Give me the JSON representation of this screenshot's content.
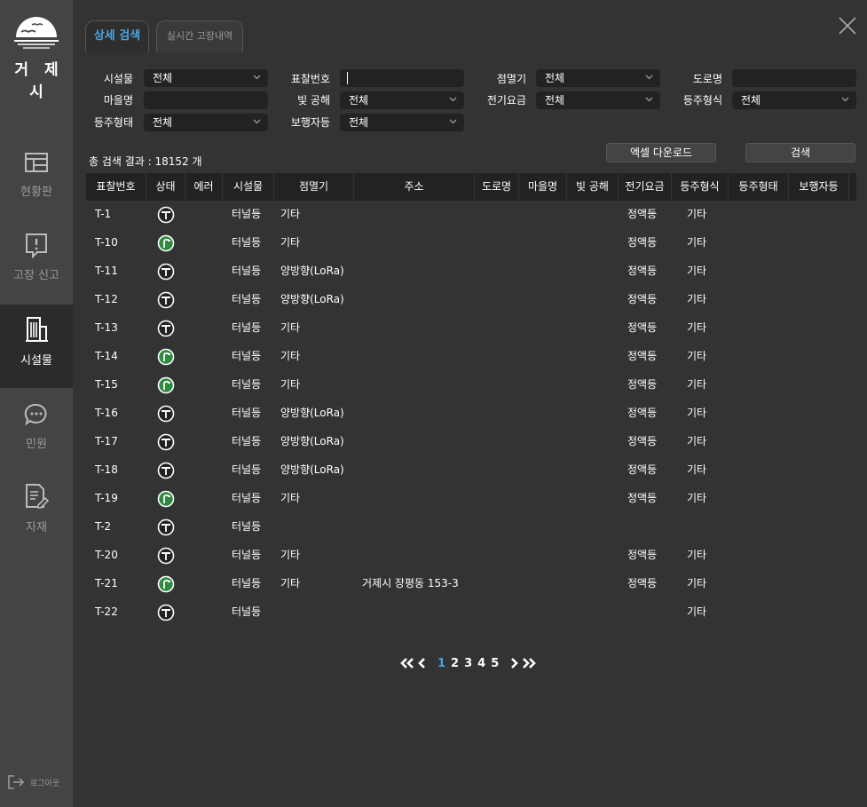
{
  "sidebar": {
    "logo_text": "거 제 시",
    "items": [
      {
        "label": "현황판",
        "icon": "dashboard-icon"
      },
      {
        "label": "고장 신고",
        "icon": "alert-report-icon"
      },
      {
        "label": "시설물",
        "icon": "building-icon",
        "active": true
      },
      {
        "label": "민원",
        "icon": "chat-icon"
      },
      {
        "label": "자재",
        "icon": "document-edit-icon"
      }
    ],
    "logout_label": "로그아웃"
  },
  "tabs": [
    {
      "label": "상세 검색",
      "active": true
    },
    {
      "label": "실시간 고장내역",
      "active": false
    }
  ],
  "filters": {
    "facility_label": "시설물",
    "facility_value": "전체",
    "tag_label": "표찰번호",
    "tag_value": "",
    "lighting_label": "점멸기",
    "lighting_value": "전체",
    "road_label": "도로명",
    "road_value": "",
    "village_label": "마을명",
    "village_value": "",
    "shared_label": "빛 공해",
    "shared_value": "전체",
    "fee_label": "전기요금",
    "fee_value": "전체",
    "lamp_type_label": "등주형식",
    "lamp_type_value": "전체",
    "pole_shape_label": "등주형태",
    "pole_shape_value": "전체",
    "pedestrian_label": "보행자등",
    "pedestrian_value": "전체"
  },
  "results": {
    "total_label": "총 검색 결과 : 18152 개",
    "excel_button": "엑셀 다운로드",
    "search_button": "검색"
  },
  "table": {
    "columns": [
      "표찰번호",
      "상태",
      "에러",
      "시설물",
      "점멸기",
      "주소",
      "도로명",
      "마을명",
      "빛 공해",
      "전기요금",
      "등주형식",
      "등주형태",
      "보행자등"
    ],
    "rows": [
      {
        "id": "T-1",
        "status": "off",
        "facility": "터널등",
        "switch": "기타",
        "address": "",
        "fee": "정액등",
        "lamp_type": "기타"
      },
      {
        "id": "T-10",
        "status": "on",
        "facility": "터널등",
        "switch": "기타",
        "address": "",
        "fee": "정액등",
        "lamp_type": "기타"
      },
      {
        "id": "T-11",
        "status": "off",
        "facility": "터널등",
        "switch": "양방향(LoRa)",
        "address": "",
        "fee": "정액등",
        "lamp_type": "기타"
      },
      {
        "id": "T-12",
        "status": "off",
        "facility": "터널등",
        "switch": "양방향(LoRa)",
        "address": "",
        "fee": "정액등",
        "lamp_type": "기타"
      },
      {
        "id": "T-13",
        "status": "off",
        "facility": "터널등",
        "switch": "기타",
        "address": "",
        "fee": "정액등",
        "lamp_type": "기타"
      },
      {
        "id": "T-14",
        "status": "on",
        "facility": "터널등",
        "switch": "기타",
        "address": "",
        "fee": "정액등",
        "lamp_type": "기타"
      },
      {
        "id": "T-15",
        "status": "on",
        "facility": "터널등",
        "switch": "기타",
        "address": "",
        "fee": "정액등",
        "lamp_type": "기타"
      },
      {
        "id": "T-16",
        "status": "off",
        "facility": "터널등",
        "switch": "양방향(LoRa)",
        "address": "",
        "fee": "정액등",
        "lamp_type": "기타"
      },
      {
        "id": "T-17",
        "status": "off",
        "facility": "터널등",
        "switch": "양방향(LoRa)",
        "address": "",
        "fee": "정액등",
        "lamp_type": "기타"
      },
      {
        "id": "T-18",
        "status": "off",
        "facility": "터널등",
        "switch": "양방향(LoRa)",
        "address": "",
        "fee": "정액등",
        "lamp_type": "기타"
      },
      {
        "id": "T-19",
        "status": "on",
        "facility": "터널등",
        "switch": "기타",
        "address": "",
        "fee": "정액등",
        "lamp_type": "기타"
      },
      {
        "id": "T-2",
        "status": "off",
        "facility": "터널등",
        "switch": "",
        "address": "",
        "fee": "",
        "lamp_type": ""
      },
      {
        "id": "T-20",
        "status": "off",
        "facility": "터널등",
        "switch": "기타",
        "address": "",
        "fee": "정액등",
        "lamp_type": "기타"
      },
      {
        "id": "T-21",
        "status": "on",
        "facility": "터널등",
        "switch": "기타",
        "address": "거제시 장평동 153-3",
        "fee": "정액등",
        "lamp_type": "기타"
      },
      {
        "id": "T-22",
        "status": "off",
        "facility": "터널등",
        "switch": "",
        "address": "",
        "fee": "",
        "lamp_type": "기타"
      }
    ]
  },
  "pagination": {
    "pages": [
      "1",
      "2",
      "3",
      "4",
      "5"
    ],
    "current": "1"
  },
  "colors": {
    "accent": "#4aa3df",
    "status_on": "#2e8b3e",
    "background": "#333333",
    "sidebar": "#444444"
  }
}
